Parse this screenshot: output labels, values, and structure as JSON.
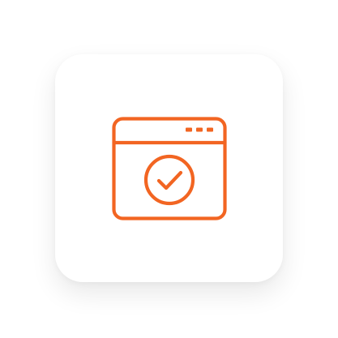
{
  "icon": {
    "name": "browser-window-check-icon",
    "accent_color": "#F26522"
  },
  "card": {
    "background": "#FFFFFF"
  }
}
